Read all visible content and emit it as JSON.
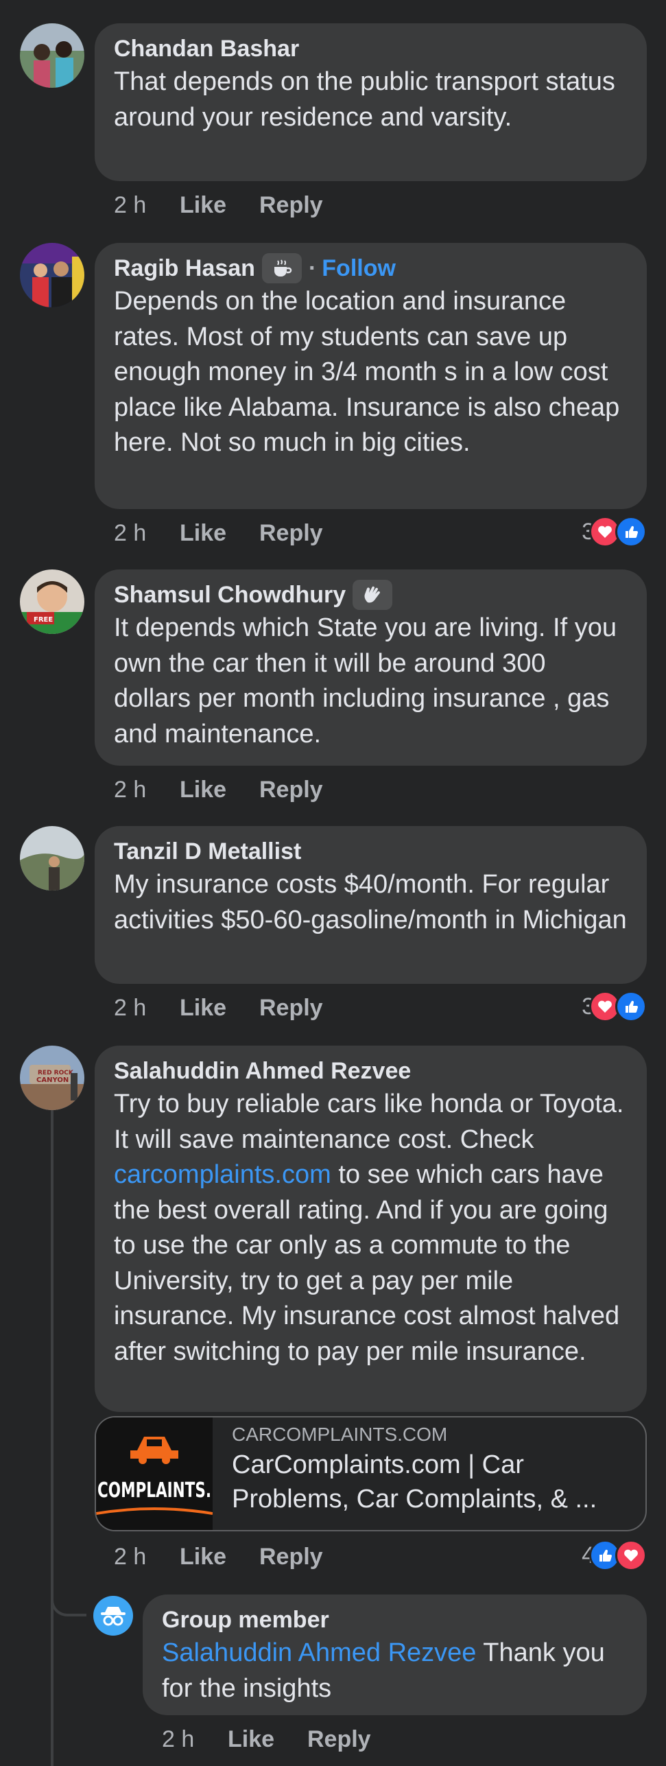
{
  "colors": {
    "background": "#242526",
    "bubble": "#3a3b3c",
    "link": "#3b97f5",
    "meta_text": "#b0b3b8",
    "heart": "#f33e58",
    "like": "#1877f2"
  },
  "actions": {
    "like": "Like",
    "reply": "Reply"
  },
  "comments": [
    {
      "name": "Chandan Bashar",
      "text": "That depends on the public transport status around your residence and varsity.",
      "time": "2 h"
    },
    {
      "name": "Ragib Hasan",
      "badge_icon": "coffee-cup-icon",
      "follow_label": "Follow",
      "separator": "·",
      "text": "Depends on the location and insurance rates. Most of my students can save up enough money in 3/4 month s in a low cost place like Alabama. Insurance is also cheap here. Not so much in big cities.",
      "time": "2 h",
      "reaction_count": "3",
      "reaction_icons": [
        "heart-icon",
        "thumbs-up-icon"
      ]
    },
    {
      "name": "Shamsul Chowdhury",
      "badge_icon": "waving-hand-icon",
      "text": "It depends which State you are living. If you own the car then it will be around 300 dollars per month including insurance , gas and maintenance.",
      "time": "2 h"
    },
    {
      "name": "Tanzil D Metallist",
      "text": "My insurance costs $40/month. For regular activities $50-60-gasoline/month in Michigan",
      "time": "2 h",
      "reaction_count": "3",
      "reaction_icons": [
        "heart-icon",
        "thumbs-up-icon"
      ]
    },
    {
      "name": "Salahuddin Ahmed Rezvee",
      "avatar_text": [
        "RED ROCK",
        "CANYON"
      ],
      "text_before_link": "Try to buy reliable cars like honda or Toyota. It will save maintenance cost. Check ",
      "link_text": "carcomplaints.com",
      "text_after_link": " to see which cars have the best overall rating. And if you are going to use the car only as a commute to the University, try to get a pay per mile insurance. My insurance cost almost halved after switching to pay per mile insurance.",
      "time": "2 h",
      "reaction_count": "4",
      "reaction_icons": [
        "thumbs-up-icon",
        "heart-icon"
      ],
      "link_preview": {
        "domain": "CARCOMPLAINTS.COM",
        "title": "CarComplaints.com | Car Problems, Car Complaints, & ...",
        "thumb_text": "COMPLAINTS."
      }
    },
    {
      "name": "Group member",
      "mention": "Salahuddin Ahmed Rezvee",
      "text": " Thank you for the insights",
      "time": "2 h"
    }
  ]
}
